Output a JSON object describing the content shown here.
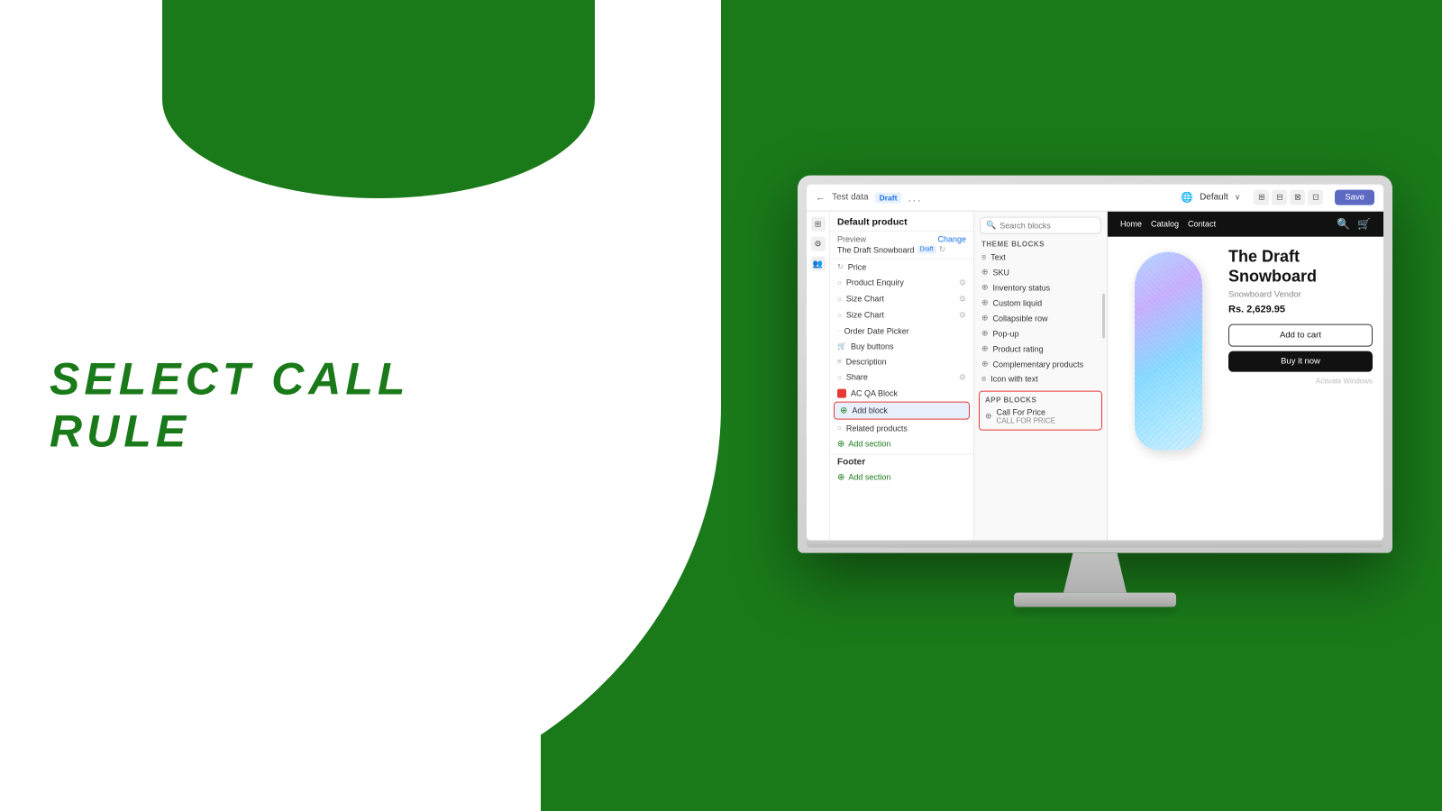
{
  "background": {
    "left_color": "#ffffff",
    "right_color": "#1a7a1a"
  },
  "hero_text": "Select Call Rule",
  "monitor": {
    "top_bar": {
      "icon_label": "←",
      "test_data_label": "Test data",
      "draft_badge": "Draft",
      "dots": "...",
      "default_label": "Default",
      "chevron": "∨",
      "save_label": "Save"
    },
    "sidebar": {
      "title": "Default product",
      "preview_label": "Preview",
      "preview_change": "Change",
      "preview_product": "The Draft Snowboard",
      "preview_draft": "Draft",
      "items": [
        {
          "id": "price",
          "label": "Price",
          "icon": "circle"
        },
        {
          "id": "product-enquiry",
          "label": "Product Enquiry",
          "icon": "circle",
          "has_settings": true
        },
        {
          "id": "size-chart-1",
          "label": "Size Chart",
          "icon": "circle",
          "has_settings": true
        },
        {
          "id": "size-chart-2",
          "label": "Size Chart",
          "icon": "circle",
          "has_settings": true
        },
        {
          "id": "order-date-picker",
          "label": "Order Date Picker",
          "icon": "dot"
        },
        {
          "id": "buy-buttons",
          "label": "Buy buttons",
          "icon": "cart"
        },
        {
          "id": "description",
          "label": "Description",
          "icon": "lines"
        },
        {
          "id": "share",
          "label": "Share",
          "icon": "circle",
          "has_settings": true
        },
        {
          "id": "ac-qa-block",
          "label": "AC QA Block",
          "icon": "red"
        },
        {
          "id": "add-block",
          "label": "Add block",
          "icon": "plus",
          "active": true
        },
        {
          "id": "related-products",
          "label": "Related products",
          "icon": "circle"
        },
        {
          "id": "add-section",
          "label": "Add section",
          "icon": "plus-green"
        }
      ],
      "footer_label": "Footer",
      "footer_add_section": "Add section"
    },
    "blocks_panel": {
      "search_placeholder": "Search blocks",
      "theme_blocks_title": "THEME BLOCKS",
      "theme_blocks": [
        {
          "id": "text",
          "label": "Text",
          "icon": "≡"
        },
        {
          "id": "sku",
          "label": "SKU",
          "icon": "⊕"
        },
        {
          "id": "inventory-status",
          "label": "Inventory status",
          "icon": "⊕"
        },
        {
          "id": "custom-liquid",
          "label": "Custom liquid",
          "icon": "⊕"
        },
        {
          "id": "collapsible-row",
          "label": "Collapsible row",
          "icon": "⊕"
        },
        {
          "id": "pop-up",
          "label": "Pop-up",
          "icon": "⊕"
        },
        {
          "id": "product-rating",
          "label": "Product rating",
          "icon": "⊕"
        },
        {
          "id": "complementary-products",
          "label": "Complementary products",
          "icon": "⊕"
        },
        {
          "id": "icon-with-text",
          "label": "Icon with text",
          "icon": "≡"
        }
      ],
      "app_blocks_title": "APP BLOCKS",
      "app_blocks": [
        {
          "id": "call-for-price",
          "label": "Call For Price",
          "sub": "CALL FOR PRICE",
          "icon": "⊕"
        }
      ]
    },
    "preview": {
      "nav_items": [
        "Home",
        "Catalog",
        "Contact"
      ],
      "product_title": "The Draft Snowboard",
      "product_vendor": "Snowboard Vendor",
      "product_price": "Rs. 2,629.95",
      "add_to_cart_label": "Add to cart",
      "buy_now_label": "Buy it now",
      "activate_windows_text": "Activate Windows"
    }
  }
}
